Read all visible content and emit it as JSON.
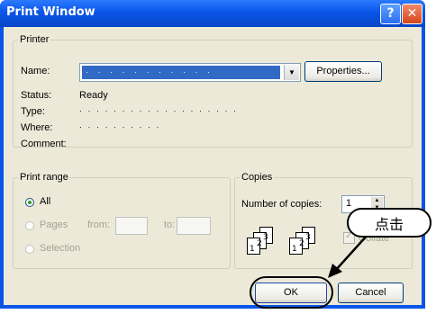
{
  "title": "Print Window",
  "title_buttons": {
    "help": "?",
    "close": "✕"
  },
  "printer": {
    "legend": "Printer",
    "name_label": "Name:",
    "name_value": "· · · · · · · · · · ·",
    "properties_button": "Properties...",
    "status_label": "Status:",
    "status_value": "Ready",
    "type_label": "Type:",
    "type_value": "· · · · · · · · · ·   · · · · · · · · ·",
    "where_label": "Where:",
    "where_value": "· · · · · · · · · ·",
    "comment_label": "Comment:"
  },
  "print_range": {
    "legend": "Print range",
    "all": "All",
    "pages": "Pages",
    "from": "from:",
    "to": "to:",
    "selection": "Selection"
  },
  "copies": {
    "legend": "Copies",
    "number_label": "Number of copies:",
    "number_value": "1",
    "collate": "Collate"
  },
  "buttons": {
    "ok": "OK",
    "cancel": "Cancel"
  },
  "callout": "点击"
}
